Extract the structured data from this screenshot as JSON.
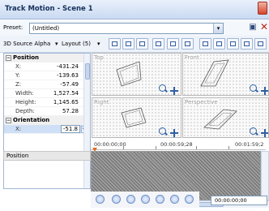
{
  "window": {
    "title": "Track Motion - Scene 1"
  },
  "preset": {
    "label": "Preset:",
    "value": "(Untitled)"
  },
  "toolbar": {
    "source_alpha": "3D Source Alpha",
    "layout": "Layout (5)"
  },
  "properties": {
    "sections": [
      {
        "title": "Position",
        "rows": [
          {
            "key": "X:",
            "value": "-431.24"
          },
          {
            "key": "Y:",
            "value": "-139.63"
          },
          {
            "key": "Z:",
            "value": "-57.49"
          },
          {
            "key": "Width:",
            "value": "1,527.54"
          },
          {
            "key": "Height:",
            "value": "1,145.65"
          },
          {
            "key": "Depth:",
            "value": "57.28"
          }
        ]
      },
      {
        "title": "Orientation",
        "rows": [
          {
            "key": "X:",
            "value": "-51.8"
          }
        ]
      }
    ]
  },
  "viewports": {
    "top": "Top",
    "front": "Front",
    "right": "Right",
    "perspective": "Perspective"
  },
  "timeline": {
    "ruler": [
      "00:00:00;00",
      "00:00:59;28",
      "00:01:59;2"
    ],
    "track_label": "Position",
    "timecode": "00:00:00;00"
  },
  "colors": {
    "accent": "#2f5fa5",
    "title_text": "#15305b",
    "delete": "#c0261b",
    "marker": "#e06c1c"
  }
}
